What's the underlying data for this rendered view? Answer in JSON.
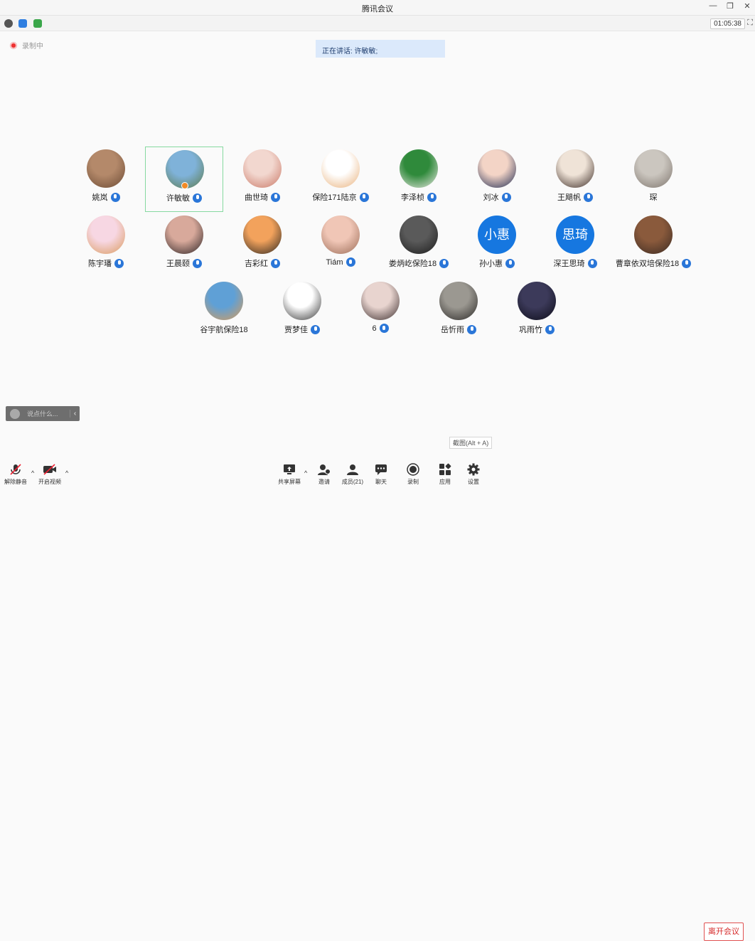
{
  "window": {
    "title": "腾讯会议",
    "controls": [
      "—",
      "❐",
      "✕"
    ]
  },
  "status": {
    "timer": "01:05:38",
    "recording_label": "录制中"
  },
  "speaking": {
    "label": "正在讲话: 许敏敏;"
  },
  "participants": [
    {
      "name": "姚岚",
      "mic": true,
      "avatar": "dog-photo",
      "colors": [
        "#b4896a",
        "#6b4a34"
      ]
    },
    {
      "name": "许敏敏",
      "mic": true,
      "active": true,
      "avatar": "landscape-photo",
      "colors": [
        "#7fb2d9",
        "#5c7a4a"
      ]
    },
    {
      "name": "曲世琦",
      "mic": true,
      "avatar": "anime-photo",
      "colors": [
        "#f2d7cf",
        "#c97765"
      ]
    },
    {
      "name": "保险171陆京",
      "mic": true,
      "avatar": "cartoon-photo",
      "colors": [
        "#ffffff",
        "#e8b07a"
      ]
    },
    {
      "name": "李泽桢",
      "mic": true,
      "avatar": "football-photo",
      "colors": [
        "#2f8a3b",
        "#ece9e4"
      ]
    },
    {
      "name": "刘冰",
      "mic": true,
      "avatar": "anime-girl-photo",
      "colors": [
        "#f3d4c6",
        "#1d2a52"
      ]
    },
    {
      "name": "王飓帆",
      "mic": true,
      "avatar": "portrait-photo",
      "colors": [
        "#efe3d7",
        "#3a2a24"
      ]
    },
    {
      "name": "琛",
      "mic": false,
      "avatar": "cat-photo",
      "colors": [
        "#cbc6bf",
        "#7d746c"
      ]
    },
    {
      "name": "陈宇璠",
      "mic": true,
      "avatar": "shiba-photo",
      "colors": [
        "#f7d7e3",
        "#d99a5d"
      ]
    },
    {
      "name": "王晨颐",
      "mic": true,
      "avatar": "woman-photo",
      "colors": [
        "#d8a99b",
        "#2c2324"
      ]
    },
    {
      "name": "吉彩红",
      "mic": true,
      "avatar": "sunset-photo",
      "colors": [
        "#f2a25c",
        "#2c2620"
      ]
    },
    {
      "name": "Tiám",
      "mic": true,
      "avatar": "bear-photo",
      "colors": [
        "#f0c6b6",
        "#9a6b56"
      ]
    },
    {
      "name": "娄炳屹保险18",
      "mic": true,
      "avatar": "anime-boy-photo",
      "colors": [
        "#5a5a5a",
        "#1c1c1c"
      ]
    },
    {
      "name": "孙小惠",
      "mic": true,
      "avatar_text": "小惠"
    },
    {
      "name": "深王思琦",
      "mic": true,
      "avatar_text": "思琦"
    },
    {
      "name": "曹章依双培保险18",
      "mic": true,
      "avatar": "teddy-photo",
      "colors": [
        "#8a5a3c",
        "#3a2a22"
      ]
    },
    {
      "name": "谷宇航保险18",
      "mic": false,
      "avatar": "dog-sky-photo",
      "colors": [
        "#5fa0d6",
        "#d99b58"
      ]
    },
    {
      "name": "贾梦佳",
      "mic": true,
      "avatar": "doodle-photo",
      "colors": [
        "#ffffff",
        "#333333"
      ]
    },
    {
      "name": "6",
      "mic": true,
      "avatar": "girl-photo",
      "colors": [
        "#e8d4cf",
        "#3a2c2c"
      ]
    },
    {
      "name": "岳忻雨",
      "mic": true,
      "avatar": "husky-photo",
      "colors": [
        "#9b9891",
        "#2a2826"
      ]
    },
    {
      "name": "巩雨竹",
      "mic": true,
      "avatar": "night-photo",
      "colors": [
        "#3c3a5a",
        "#0c0c18"
      ]
    }
  ],
  "chat": {
    "placeholder": "说点什么..."
  },
  "tooltip": {
    "text": "截图(Alt + A)"
  },
  "toolbar": {
    "unmute": "解除静音",
    "video": "开启视频",
    "share": "共享屏幕",
    "invite": "邀请",
    "members": "成员(21)",
    "chat": "聊天",
    "record": "录制",
    "apps": "应用",
    "settings": "设置",
    "leave": "离开会议"
  },
  "colors": {
    "accent": "#1677e0",
    "active_border": "#86d9a0",
    "leave": "#d62b2b"
  }
}
